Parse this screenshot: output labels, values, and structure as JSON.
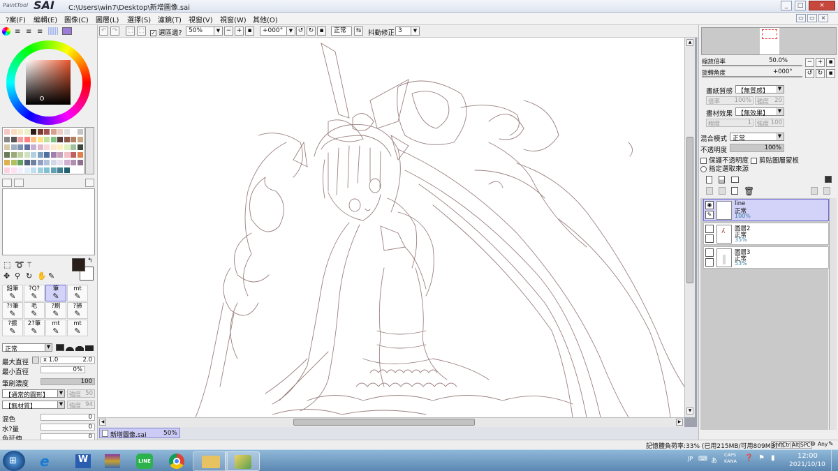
{
  "app": {
    "title": "C:\\Users\\win7\\Desktop\\新增圖像.sai",
    "logo_small": "PaintTool",
    "logo_big": "SAI"
  },
  "window_buttons": [
    "_",
    "□",
    "×"
  ],
  "canvas_window_buttons": [
    "▭",
    "▭",
    "×"
  ],
  "menu": [
    "?案(F)",
    "編輯(E)",
    "圖像(C)",
    "圖層(L)",
    "選擇(S)",
    "濾鏡(T)",
    "視窗(V)",
    "視窗(W)",
    "其他(O)"
  ],
  "toolbar": {
    "selection_check": "選區邊?",
    "zoom": "50%",
    "rotation": "+000°",
    "mode": "正常",
    "stabilizer_label": "抖動修正",
    "stabilizer_value": "3"
  },
  "navigator": {
    "zoom_label": "縮放倍率",
    "zoom_value": "50.0%",
    "rotate_label": "旋轉角度",
    "rotate_value": "+000°"
  },
  "paper": {
    "texture_label": "畫紙質感",
    "texture_value": "【無質感】",
    "scale_label": "倍率",
    "scale_value": "100%",
    "strength_label": "強度",
    "strength_value": "20",
    "effect_label": "畫材效果",
    "effect_value": "【無效果】",
    "degree_label": "程度",
    "degree_value": "1",
    "effect_strength_label": "強度",
    "effect_strength_value": "100"
  },
  "layer_props": {
    "blend_label": "混合模式",
    "blend_value": "正常",
    "opacity_label": "不透明度",
    "opacity_value": "100%",
    "opacity_fraction": 1.0,
    "protect_opacity": "保護不透明度",
    "clipping": "剪貼圖層蒙板",
    "selection_source": "指定選取來源"
  },
  "layers": [
    {
      "name": "line",
      "mode": "正常",
      "opacity": "100%",
      "selected": true
    },
    {
      "name": "圖層2",
      "mode": "正常",
      "opacity": "35%",
      "selected": false
    },
    {
      "name": "圖層3",
      "mode": "正常",
      "opacity": "53%",
      "selected": false
    }
  ],
  "tools": [
    [
      "鉛筆",
      "?Q?",
      "筆",
      "mt"
    ],
    [
      "?ﾘ筆",
      "毛",
      "?刷",
      "?掃"
    ],
    [
      "?擦",
      "2?筆",
      "mt",
      "mt"
    ]
  ],
  "brush": {
    "mode": "正常",
    "max_size_label": "最大直徑",
    "max_size_mult": "x 1.0",
    "max_size_value": "2.0",
    "min_size_label": "最小直徑",
    "min_size_value": "0%",
    "density_label": "筆刷濃度",
    "density_value": "100",
    "density_fraction": 1.0,
    "shape_value": "【通常的圓形】",
    "shape_strength_label": "強度",
    "shape_strength_value": "50",
    "texture_value": "【無材質】",
    "texture_strength_label": "強度",
    "texture_strength_value": "94",
    "blend_label": "混色",
    "blend_value": "0",
    "water_label": "水?量",
    "water_value": "0",
    "color_extend_label": "色延伸",
    "color_extend_value": "0"
  },
  "file_tab": {
    "name": "新增圖像.sai",
    "zoom": "50%"
  },
  "status": {
    "memory": "記憶體負荷率:33% (已用215MB/可用809MB)",
    "keys": [
      "Shft",
      "Ctrl",
      "Alt",
      "SPC"
    ],
    "any": "Any"
  },
  "taskbar": {
    "ime": "JP",
    "caps": "CAPS",
    "kana": "KANA",
    "time": "12:00",
    "date": "2021/10/10"
  },
  "colors": {
    "current": "#2a1e1a",
    "secondary": "#ffffff",
    "selection": "#d3d3fa",
    "accent": "#6c6cd6"
  },
  "palette": [
    "#f4c7c7",
    "#f9dcc2",
    "#f6ebc6",
    "#e9f2c9",
    "#2e1c18",
    "#7a3b2e",
    "#a05050",
    "#d7a090",
    "#e8d0c8",
    "#e0e0e0",
    "#ffffff",
    "#c4c4c4",
    "#888888",
    "#555555",
    "#f0a0a0",
    "#ff8080",
    "#ffc080",
    "#ffe080",
    "#c0e0a0",
    "#80c080",
    "#5a3a3a",
    "#8a5a4a",
    "#b08060",
    "#c8a880",
    "#d8c8a8",
    "#a0b0c0",
    "#8090b0",
    "#6070a0",
    "#c8b0d0",
    "#e0b8c8",
    "#f8d8d8",
    "#ffe8d0",
    "#fff0c0",
    "#e0f0c0",
    "#a0c0a0",
    "#3a4a3a",
    "#6a7a5a",
    "#9aaa7a",
    "#c0d0a0",
    "#d0e0c0",
    "#b0d0e0",
    "#80a0c0",
    "#5070a0",
    "#a080b0",
    "#c8a0b8",
    "#f0c0c8",
    "#c06060",
    "#e08050",
    "#e0b050",
    "#b0c060",
    "#60a060",
    "#506080",
    "#7080a0",
    "#90a0c0",
    "#b0c0d8",
    "#d0d8e8",
    "#e8e0f0",
    "#d0b0d0",
    "#b090b0",
    "#907090",
    "#ffd0e0",
    "#ffe0f0",
    "#f0f0ff",
    "#e0f0ff",
    "#c0e0f0",
    "#a0d0e0",
    "#80c0d0",
    "#60a0b0",
    "#408090",
    "#206070"
  ]
}
